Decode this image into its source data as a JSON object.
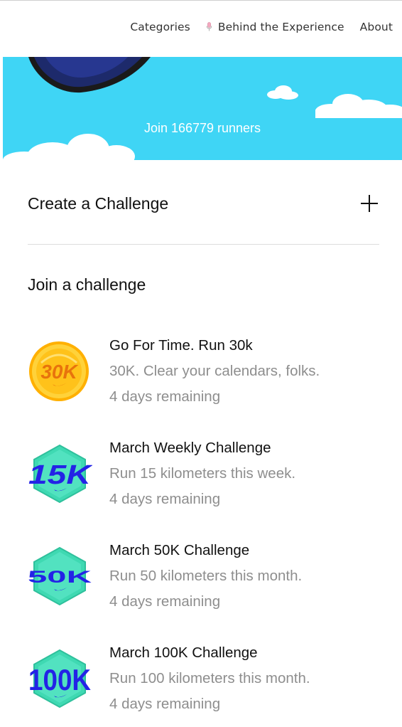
{
  "nav": {
    "links": [
      {
        "label": "Categories"
      },
      {
        "label": "Behind the Experience",
        "icon": "microphone-icon"
      },
      {
        "label": "About"
      }
    ]
  },
  "hero": {
    "caption": "Join 166779 runners",
    "background": "#3fd5f5"
  },
  "create": {
    "title": "Create a Challenge",
    "icon": "plus-icon"
  },
  "join": {
    "title": "Join a challenge"
  },
  "challenges": [
    {
      "name": "Go For Time. Run 30k",
      "description": "30K. Clear your calendars, folks.",
      "remaining": "4 days remaining",
      "badge": "30K",
      "badge_shape": "gold-coin"
    },
    {
      "name": "March Weekly Challenge",
      "description": "Run 15 kilometers this week.",
      "remaining": "4 days remaining",
      "badge": "15K",
      "badge_shape": "teal-hexagon"
    },
    {
      "name": "March 50K Challenge",
      "description": "Run 50 kilometers this month.",
      "remaining": "4 days remaining",
      "badge": "50K",
      "badge_shape": "teal-hexagon"
    },
    {
      "name": "March 100K Challenge",
      "description": "Run 100 kilometers this month.",
      "remaining": "4 days remaining",
      "badge": "100K",
      "badge_shape": "teal-hexagon"
    }
  ],
  "colors": {
    "hero_sky": "#3fd5f5",
    "badge_teal": "#3fd9b2",
    "badge_blue": "#2323e6",
    "badge_gold": "#ffc21a",
    "badge_text_orange": "#e8730c",
    "muted_text": "#8e8e8e"
  }
}
